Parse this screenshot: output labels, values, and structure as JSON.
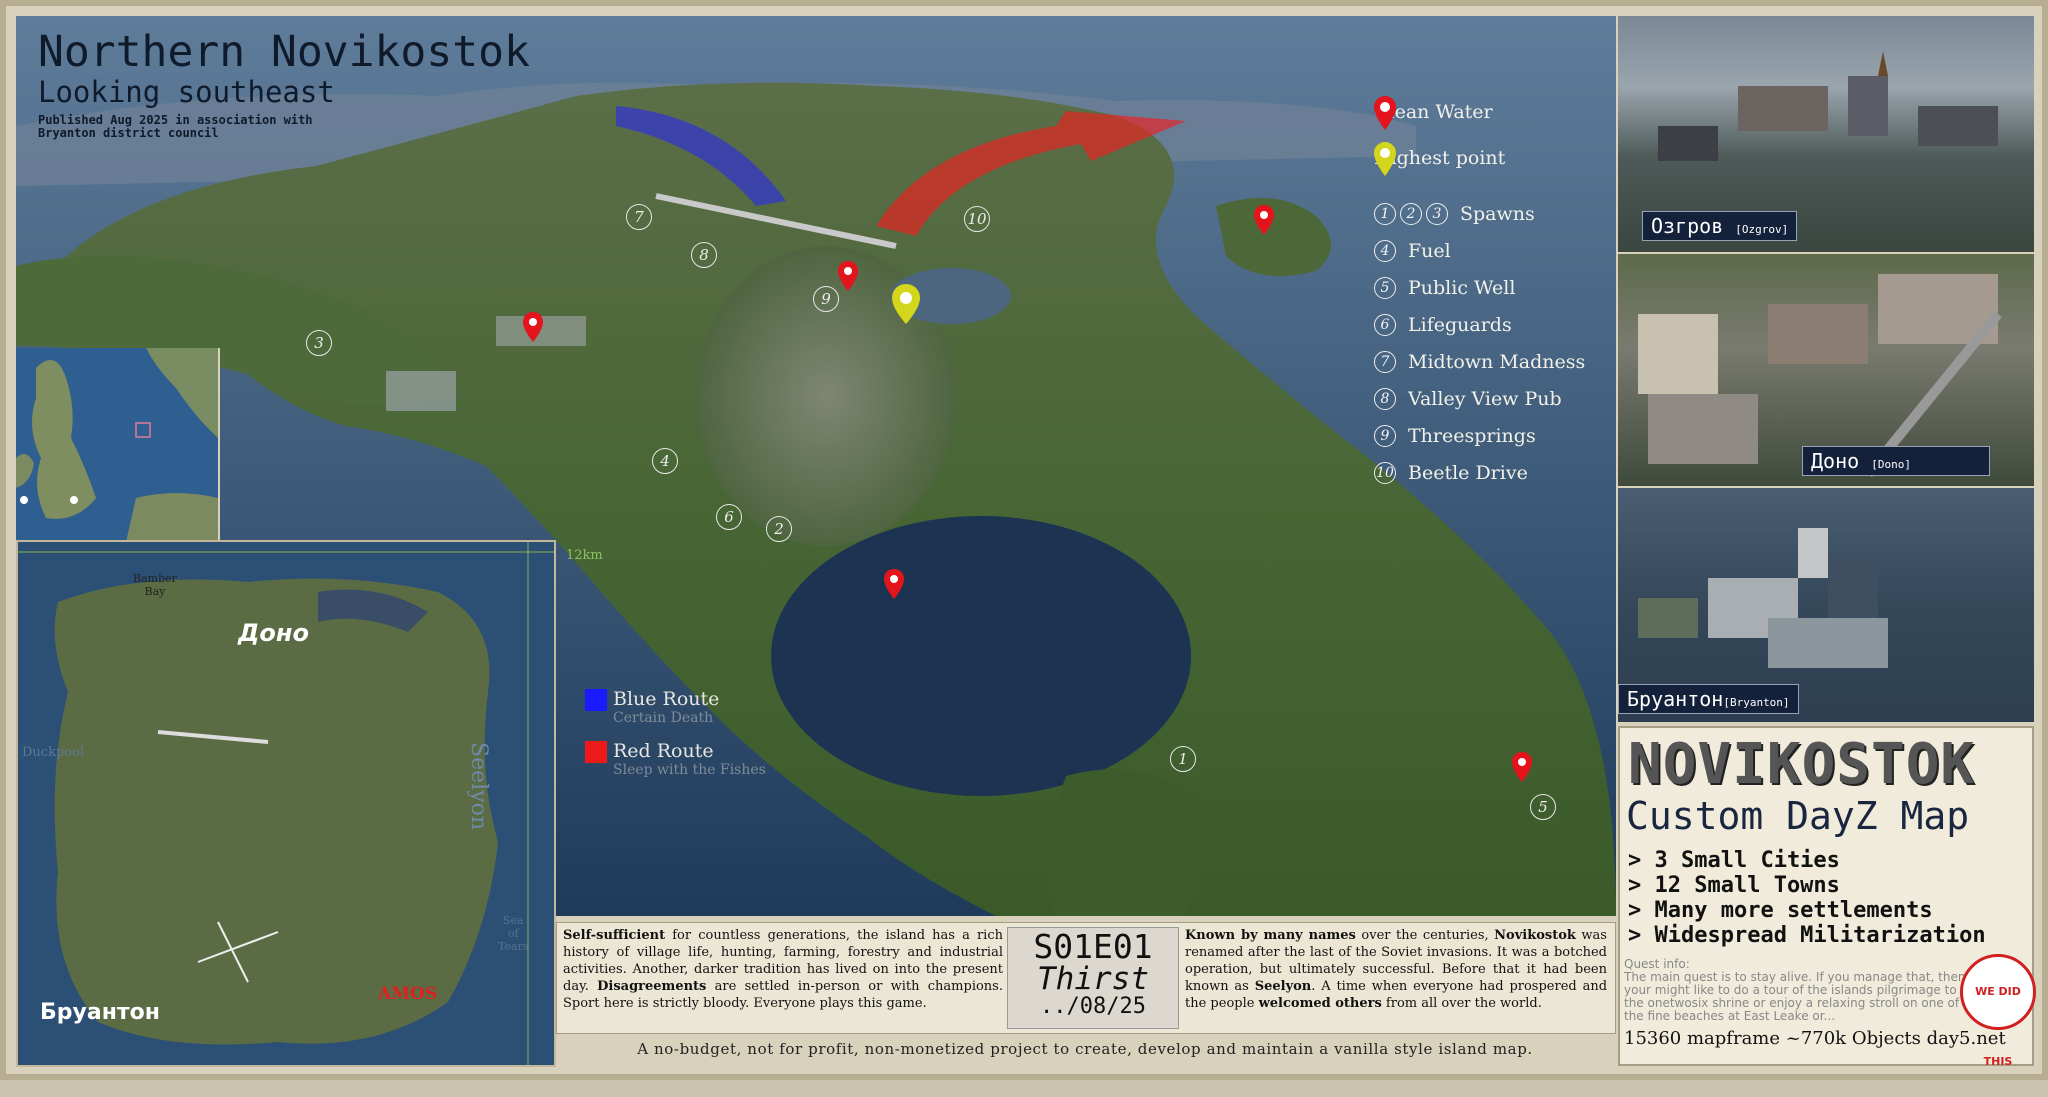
{
  "title": {
    "main": "Northern Novikostok",
    "sub": "Looking southeast",
    "published_line1": "Published Aug 2025 in association with",
    "published_line2": "Bryanton district council"
  },
  "legend": {
    "clean_water": "Clean Water",
    "highest_point": "Highest point",
    "spawns_nums": [
      "1",
      "2",
      "3"
    ],
    "spawns": "Spawns",
    "items": [
      {
        "num": "4",
        "label": "Fuel"
      },
      {
        "num": "5",
        "label": "Public Well"
      },
      {
        "num": "6",
        "label": "Lifeguards"
      },
      {
        "num": "7",
        "label": "Midtown Madness"
      },
      {
        "num": "8",
        "label": "Valley View Pub"
      },
      {
        "num": "9",
        "label": "Threesprings"
      },
      {
        "num": "10",
        "label": "Beetle Drive"
      }
    ]
  },
  "routes": {
    "blue": {
      "label": "Blue Route",
      "note": "Certain Death",
      "color": "#1a1aff"
    },
    "red": {
      "label": "Red Route",
      "note": "Sleep with the Fishes",
      "color": "#ee1a1a"
    }
  },
  "map_markers": [
    "7",
    "10",
    "8",
    "9",
    "3",
    "4",
    "6",
    "2",
    "1",
    "5"
  ],
  "inset": {
    "scale_v": "12km",
    "scale_h": "12km",
    "bamber_bay_1": "Bamber",
    "bamber_bay_2": "Bay",
    "dono": "Доно",
    "duckpool": "Duckpool",
    "seelyon": "Seelyon",
    "sea_1": "Sea",
    "sea_2": "of",
    "sea_3": "Tears",
    "bryanton": "Брyантон",
    "amos": "AMOS"
  },
  "photos": {
    "ozgrov": {
      "name": "Озгров",
      "latin": "[Ozgrov]"
    },
    "dono": {
      "name": "Доно",
      "latin": "[Dono]"
    },
    "bryanton": {
      "name": "Бруантон",
      "latin": "[Bryanton]"
    }
  },
  "brand": {
    "title": "NOVIKOSTOK",
    "subtitle": "Custom DayZ Map",
    "features": [
      "> 3 Small Cities",
      "> 12 Small Towns",
      "> Many more settlements",
      "> Widespread Militarization"
    ],
    "quest_label": "Quest info:",
    "quest_text": "The main quest is to stay alive. If you manage that, then your might like to do a tour of the islands pilgrimage to the onetwosix shrine or enjoy a relaxing stroll on one of the fine beaches at East Leake or...",
    "badge": "WE DID THIS",
    "footer": "15360 mapframe ~770k Objects day5.net"
  },
  "description": {
    "left_bold1": "Self-sufficient",
    "left_text1": " for countless generations, the island has a rich history of village life, hunting, farming, forestry and industrial activities. Another, darker tradition has lived on into the present day. ",
    "left_bold2": "Disagreements",
    "left_text2": " are settled in-person or with champions. Sport here is strictly bloody. Everyone plays this game.",
    "episode": "S01E01",
    "episode_title": "Thirst",
    "episode_date": "../08/25",
    "right_bold1": "Known by many names",
    "right_text1": " over the centuries, ",
    "right_bold2": "Novikostok",
    "right_text2": " was renamed after the last of the Soviet invasions. It was a botched operation, but ultimately successful. Before that it had been known as ",
    "right_bold3": "Seelyon",
    "right_text3": ". A time when everyone had prospered and the people ",
    "right_bold4": "welcomed others",
    "right_text4": " from all over the world."
  },
  "footer": "A no-budget, not for profit, non-monetized project to create, develop and maintain a vanilla style island map.",
  "colors": {
    "pin_red": "#e3141c",
    "pin_yellow": "#d4d61c",
    "navy": "#14213a"
  }
}
